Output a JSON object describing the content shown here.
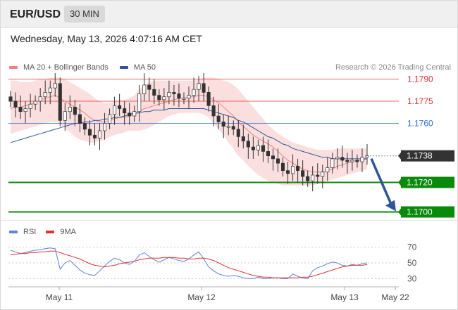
{
  "header": {
    "symbol": "EUR/USD",
    "timeframe": "30 MIN"
  },
  "datetime": "Wednesday, May 13, 2026 4:07:16 AM CET",
  "legend": {
    "bollinger_label": "MA 20 + Bollinger Bands",
    "ma50_label": "MA 50",
    "bollinger_color": "#f08080",
    "ma50_color": "#2f5597"
  },
  "research": "Research © 2026 Trading Central",
  "rsi_legend": {
    "rsi_label": "RSI",
    "ma9_label": "9MA",
    "rsi_color": "#5b84d6",
    "ma9_color": "#e03030"
  },
  "chart_data": [
    {
      "type": "candlestick",
      "title": "EUR/USD",
      "timeframe": "30 MIN",
      "x_ticks": [
        "May 11",
        "May 12",
        "May 13",
        "May 22"
      ],
      "ylim": [
        1.1695,
        1.1795
      ],
      "levels": [
        {
          "value": "1.1790",
          "kind": "resistance",
          "color": "#e03030"
        },
        {
          "value": "1.1775",
          "kind": "resistance",
          "color": "#e03030"
        },
        {
          "value": "1.1760",
          "kind": "resistance",
          "color": "#2f6fe0"
        },
        {
          "value": "1.1738",
          "kind": "last",
          "color": "#333333"
        },
        {
          "value": "1.1720",
          "kind": "support",
          "color": "#0a8a0a"
        },
        {
          "value": "1.1700",
          "kind": "support",
          "color": "#0a8a0a"
        }
      ],
      "close_series": [
        1.1775,
        1.1771,
        1.1768,
        1.177,
        1.1773,
        1.1775,
        1.1778,
        1.1781,
        1.1784,
        1.1787,
        1.1762,
        1.1768,
        1.1771,
        1.1766,
        1.176,
        1.1756,
        1.1752,
        1.175,
        1.1755,
        1.176,
        1.1766,
        1.1772,
        1.177,
        1.1767,
        1.1765,
        1.1768,
        1.178,
        1.1786,
        1.1783,
        1.1779,
        1.1776,
        1.1778,
        1.1781,
        1.178,
        1.1777,
        1.1777,
        1.1779,
        1.1783,
        1.1787,
        1.1781,
        1.1772,
        1.1765,
        1.1761,
        1.1758,
        1.1758,
        1.1756,
        1.1751,
        1.1748,
        1.1744,
        1.1742,
        1.1745,
        1.1741,
        1.1738,
        1.1736,
        1.1733,
        1.1728,
        1.1726,
        1.1731,
        1.1728,
        1.1724,
        1.1721,
        1.1725,
        1.1724,
        1.1727,
        1.173,
        1.1736,
        1.1737,
        1.1735,
        1.1734,
        1.1735,
        1.1734,
        1.1737,
        1.1738
      ],
      "ma20_series": [
        1.177,
        1.1771,
        1.1771,
        1.1772,
        1.1773,
        1.1774,
        1.1776,
        1.1777,
        1.1778,
        1.1779,
        1.1777,
        1.1775,
        1.1773,
        1.1771,
        1.1769,
        1.1767,
        1.1764,
        1.1762,
        1.1761,
        1.1761,
        1.1762,
        1.1763,
        1.1764,
        1.1764,
        1.1765,
        1.1766,
        1.1768,
        1.177,
        1.1771,
        1.1772,
        1.1773,
        1.1774,
        1.1775,
        1.1776,
        1.1777,
        1.1777,
        1.1778,
        1.1778,
        1.1779,
        1.1779,
        1.1778,
        1.1776,
        1.1774,
        1.1771,
        1.1768,
        1.1765,
        1.1761,
        1.1758,
        1.1755,
        1.1752,
        1.175,
        1.1748,
        1.1746,
        1.1744,
        1.1741,
        1.1738,
        1.1735,
        1.1733,
        1.1731,
        1.1729,
        1.1728,
        1.1727,
        1.1727,
        1.1727,
        1.1728,
        1.1729,
        1.1731,
        1.1732,
        1.1733,
        1.1734,
        1.1735,
        1.1735,
        1.1736
      ],
      "bb_upper_series": [
        1.1789,
        1.1789,
        1.1788,
        1.1788,
        1.1788,
        1.1789,
        1.179,
        1.179,
        1.1791,
        1.1791,
        1.1791,
        1.179,
        1.1788,
        1.1786,
        1.1784,
        1.1782,
        1.178,
        1.1777,
        1.1775,
        1.1774,
        1.1774,
        1.1775,
        1.1776,
        1.1776,
        1.1777,
        1.1779,
        1.1783,
        1.1786,
        1.1788,
        1.1789,
        1.1789,
        1.1789,
        1.1789,
        1.1789,
        1.1789,
        1.1789,
        1.1789,
        1.1789,
        1.179,
        1.1791,
        1.1791,
        1.1791,
        1.179,
        1.1789,
        1.1788,
        1.1786,
        1.1783,
        1.1779,
        1.1775,
        1.1771,
        1.1767,
        1.1763,
        1.1759,
        1.1756,
        1.1753,
        1.1751,
        1.1749,
        1.1747,
        1.1746,
        1.1745,
        1.1744,
        1.1743,
        1.1742,
        1.1742,
        1.1742,
        1.1742,
        1.1743,
        1.1743,
        1.1743,
        1.1743,
        1.1743,
        1.1743,
        1.1743
      ],
      "bb_lower_series": [
        1.1753,
        1.1754,
        1.1755,
        1.1756,
        1.1757,
        1.1758,
        1.1759,
        1.176,
        1.1761,
        1.1761,
        1.176,
        1.1757,
        1.1754,
        1.1751,
        1.1749,
        1.1748,
        1.1747,
        1.1747,
        1.1748,
        1.1749,
        1.1751,
        1.1752,
        1.1753,
        1.1754,
        1.1755,
        1.1755,
        1.1755,
        1.1756,
        1.1757,
        1.1759,
        1.1761,
        1.1763,
        1.1765,
        1.1766,
        1.1767,
        1.1767,
        1.1767,
        1.1767,
        1.1767,
        1.1766,
        1.1764,
        1.176,
        1.1756,
        1.1752,
        1.1747,
        1.1743,
        1.1738,
        1.1735,
        1.1731,
        1.1728,
        1.1725,
        1.1723,
        1.1721,
        1.172,
        1.1719,
        1.1718,
        1.1718,
        1.1718,
        1.1718,
        1.1718,
        1.1718,
        1.1718,
        1.1719,
        1.172,
        1.1721,
        1.1722,
        1.1723,
        1.1724,
        1.1725,
        1.1726,
        1.1727,
        1.1728,
        1.1729
      ],
      "ma50_series": [
        1.1747,
        1.1748,
        1.1749,
        1.175,
        1.1751,
        1.1752,
        1.1753,
        1.1754,
        1.1755,
        1.1756,
        1.1757,
        1.1758,
        1.1759,
        1.176,
        1.176,
        1.1761,
        1.1761,
        1.1762,
        1.1762,
        1.1763,
        1.1763,
        1.1764,
        1.1764,
        1.1765,
        1.1766,
        1.1767,
        1.1767,
        1.1768,
        1.1768,
        1.1769,
        1.1769,
        1.1769,
        1.177,
        1.177,
        1.177,
        1.177,
        1.177,
        1.177,
        1.177,
        1.177,
        1.1769,
        1.1768,
        1.1767,
        1.1766,
        1.1765,
        1.1764,
        1.1762,
        1.1761,
        1.1759,
        1.1757,
        1.1755,
        1.1753,
        1.1751,
        1.175,
        1.1748,
        1.1746,
        1.1745,
        1.1743,
        1.1742,
        1.1741,
        1.174,
        1.1739,
        1.1738,
        1.1737,
        1.1737,
        1.1736,
        1.1736,
        1.1736,
        1.1736,
        1.1736,
        1.1736,
        1.1736,
        1.1736
      ],
      "forecast": {
        "from": "1.1738",
        "to": "1.1700",
        "direction": "down"
      }
    },
    {
      "type": "line",
      "title": "RSI",
      "ylim": [
        25,
        75
      ],
      "y_ticks": [
        "70",
        "50",
        "30"
      ],
      "rsi_series": [
        66,
        64,
        62,
        63,
        65,
        66,
        67,
        68,
        69,
        68,
        42,
        50,
        53,
        47,
        41,
        37,
        35,
        34,
        40,
        46,
        52,
        56,
        54,
        50,
        48,
        52,
        60,
        63,
        58,
        54,
        51,
        54,
        57,
        55,
        53,
        52,
        55,
        60,
        64,
        55,
        45,
        40,
        36,
        34,
        33,
        34,
        33,
        31,
        30,
        30,
        32,
        30,
        30,
        31,
        31,
        30,
        30,
        36,
        33,
        31,
        30,
        40,
        44,
        46,
        49,
        51,
        50,
        47,
        46,
        48,
        47,
        49,
        50
      ],
      "ma9_series": [
        60,
        61,
        62,
        62,
        63,
        63,
        64,
        64,
        65,
        65,
        63,
        61,
        59,
        57,
        55,
        52,
        49,
        47,
        46,
        45,
        46,
        47,
        49,
        50,
        51,
        52,
        54,
        55,
        56,
        56,
        56,
        57,
        57,
        57,
        56,
        56,
        55,
        55,
        56,
        56,
        55,
        53,
        50,
        47,
        44,
        42,
        40,
        38,
        36,
        34,
        33,
        32,
        32,
        31,
        31,
        31,
        31,
        31,
        31,
        32,
        32,
        33,
        35,
        37,
        39,
        41,
        43,
        45,
        46,
        47,
        47,
        47,
        48
      ]
    }
  ]
}
